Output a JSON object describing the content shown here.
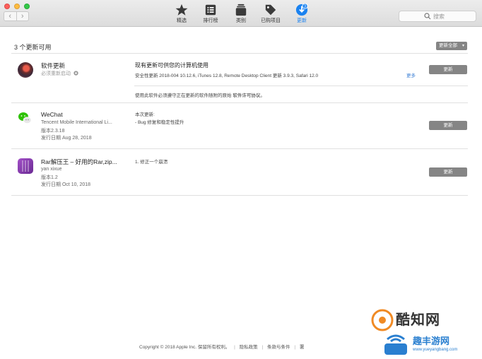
{
  "window": {
    "back_label": "‹",
    "forward_label": "›"
  },
  "toolbar": {
    "tabs": [
      {
        "label": "精选",
        "icon": "star-icon"
      },
      {
        "label": "排行榜",
        "icon": "list-icon"
      },
      {
        "label": "类别",
        "icon": "stack-icon"
      },
      {
        "label": "已购项目",
        "icon": "tag-icon"
      },
      {
        "label": "更新",
        "icon": "updates-icon",
        "badge": "3",
        "active": true
      }
    ],
    "search_placeholder": "搜索"
  },
  "updates": {
    "title": "3 个更新可用",
    "update_all_label": "更新全部",
    "software_update": {
      "name": "软件更新",
      "subtitle": "必须重新启动",
      "description_title": "现有更新可供您的计算机使用",
      "description": "安全性更新 2018-004 10.12.6, iTunes 12.8, Remote Desktop Client 更新 3.9.3, Safari 12.0",
      "more_label": "更多",
      "button_label": "更新",
      "license_text": "使用此软件必须遵守正在更新的软件随附的原始",
      "license_link": "软件许可协议",
      "license_end": "。"
    },
    "apps": [
      {
        "name": "WeChat",
        "developer": "Tencent Mobile International Li...",
        "version": "版本2.3.18",
        "release_date": "发行日期 Aug 28, 2018",
        "notes": [
          "本次更新:",
          "- Bug 修复和稳定性提升"
        ],
        "button_label": "更新"
      },
      {
        "name": "Rar解压王 – 好用的Rar,zip...",
        "developer": "yan xixue",
        "version": "版本1.2",
        "release_date": "发行日期 Oct 10, 2018",
        "notes": [
          "1. 修正一个崩溃"
        ],
        "button_label": "更新"
      }
    ]
  },
  "footer": {
    "copyright": "Copyright © 2018 Apple Inc. 保留所有权利。",
    "privacy": "隐私政策",
    "terms": "条款与条件",
    "sep1": "|",
    "sep2": "|",
    "extra": "署"
  },
  "watermark": {
    "brand": "酷知网",
    "sub": "趣丰游网",
    "url": "www.yueyangbang.com"
  }
}
